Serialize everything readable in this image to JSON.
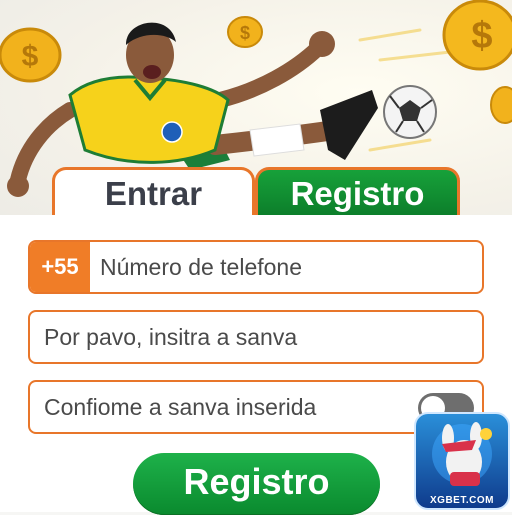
{
  "tabs": {
    "login_label": "Entrar",
    "register_label": "Registro"
  },
  "form": {
    "country_code": "+55",
    "phone_placeholder": "Número de telefone",
    "password_placeholder": "Por pavo, insitra a sanva",
    "confirm_placeholder": "Confiome a sanva inserida"
  },
  "submit_label": "Registro",
  "badge": {
    "brand_text": "XGBET.COM"
  },
  "colors": {
    "accent_orange": "#e8762a",
    "brand_green": "#0f8f33"
  },
  "icons": [
    "coin-icon",
    "soccer-ball-icon",
    "toggle-switch",
    "app-badge-icon"
  ]
}
